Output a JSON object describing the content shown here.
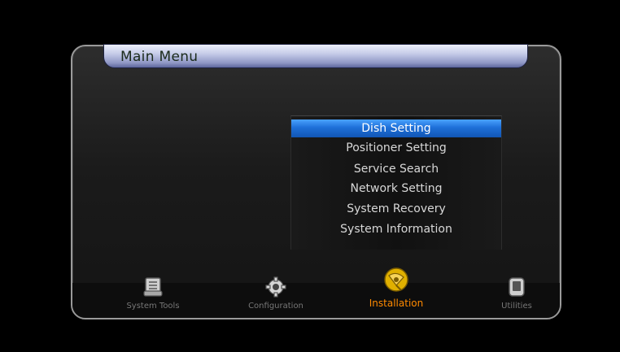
{
  "title": "Main Menu",
  "menu": {
    "items": [
      {
        "label": "Dish Setting",
        "selected": true
      },
      {
        "label": "Positioner Setting",
        "selected": false
      },
      {
        "label": "Service Search",
        "selected": false
      },
      {
        "label": "Network Setting",
        "selected": false
      },
      {
        "label": "System Recovery",
        "selected": false
      },
      {
        "label": "System Information",
        "selected": false
      }
    ]
  },
  "bottom_nav": [
    {
      "label": "System Tools",
      "icon": "system-tools-icon",
      "active": false
    },
    {
      "label": "Configuration",
      "icon": "gear-icon",
      "active": false
    },
    {
      "label": "Installation",
      "icon": "satellite-icon",
      "active": true
    },
    {
      "label": "Utilities",
      "icon": "device-icon",
      "active": false
    }
  ],
  "colors": {
    "selected_item": "#1e6fd8",
    "active_tab": "#ff8a00"
  }
}
